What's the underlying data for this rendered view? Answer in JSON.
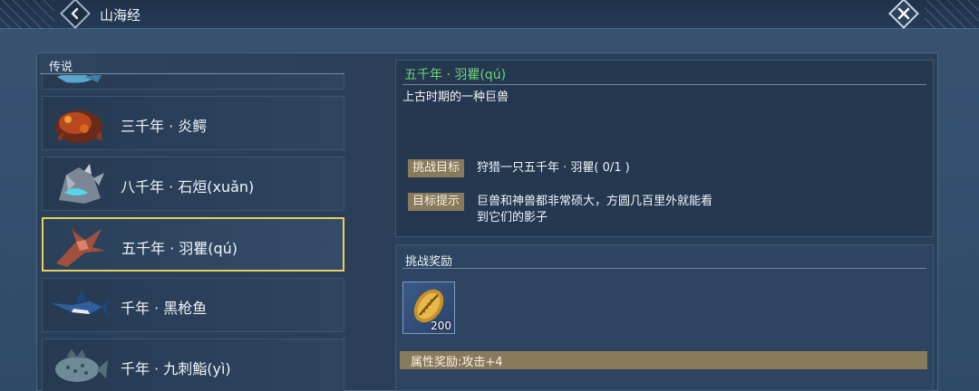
{
  "header": {
    "title": "山海经"
  },
  "list": {
    "header": "传说",
    "items": [
      {
        "label": "三千年 · 炎鳄"
      },
      {
        "label": "八千年 · 石烜(xuǎn)"
      },
      {
        "label": "五千年 · 羽瞿(qú)"
      },
      {
        "label": "千年 · 黑枪鱼"
      },
      {
        "label": "千年 · 九刺鮨(yì)"
      }
    ],
    "selected_index": 2
  },
  "detail": {
    "title": "五千年 · 羽瞿(qú)",
    "description": "上古时期的一种巨兽",
    "goal_tag": "挑战目标",
    "goal_text": "狩猎一只五千年 · 羽瞿( 0/1 )",
    "hint_tag": "目标提示",
    "hint_text_line1": "巨兽和神兽都非常硕大，方圆几百里外就能看",
    "hint_text_line2": "到它们的影子"
  },
  "reward": {
    "title": "挑战奖励",
    "item_icon": "golden-shell-icon",
    "item_quantity": "200",
    "attribute_bonus": "属性奖励:攻击+4"
  },
  "colors": {
    "accent_green": "#6fd37c",
    "selection_gold": "#e5cf63",
    "tag_bg": "#8a7a5c"
  }
}
